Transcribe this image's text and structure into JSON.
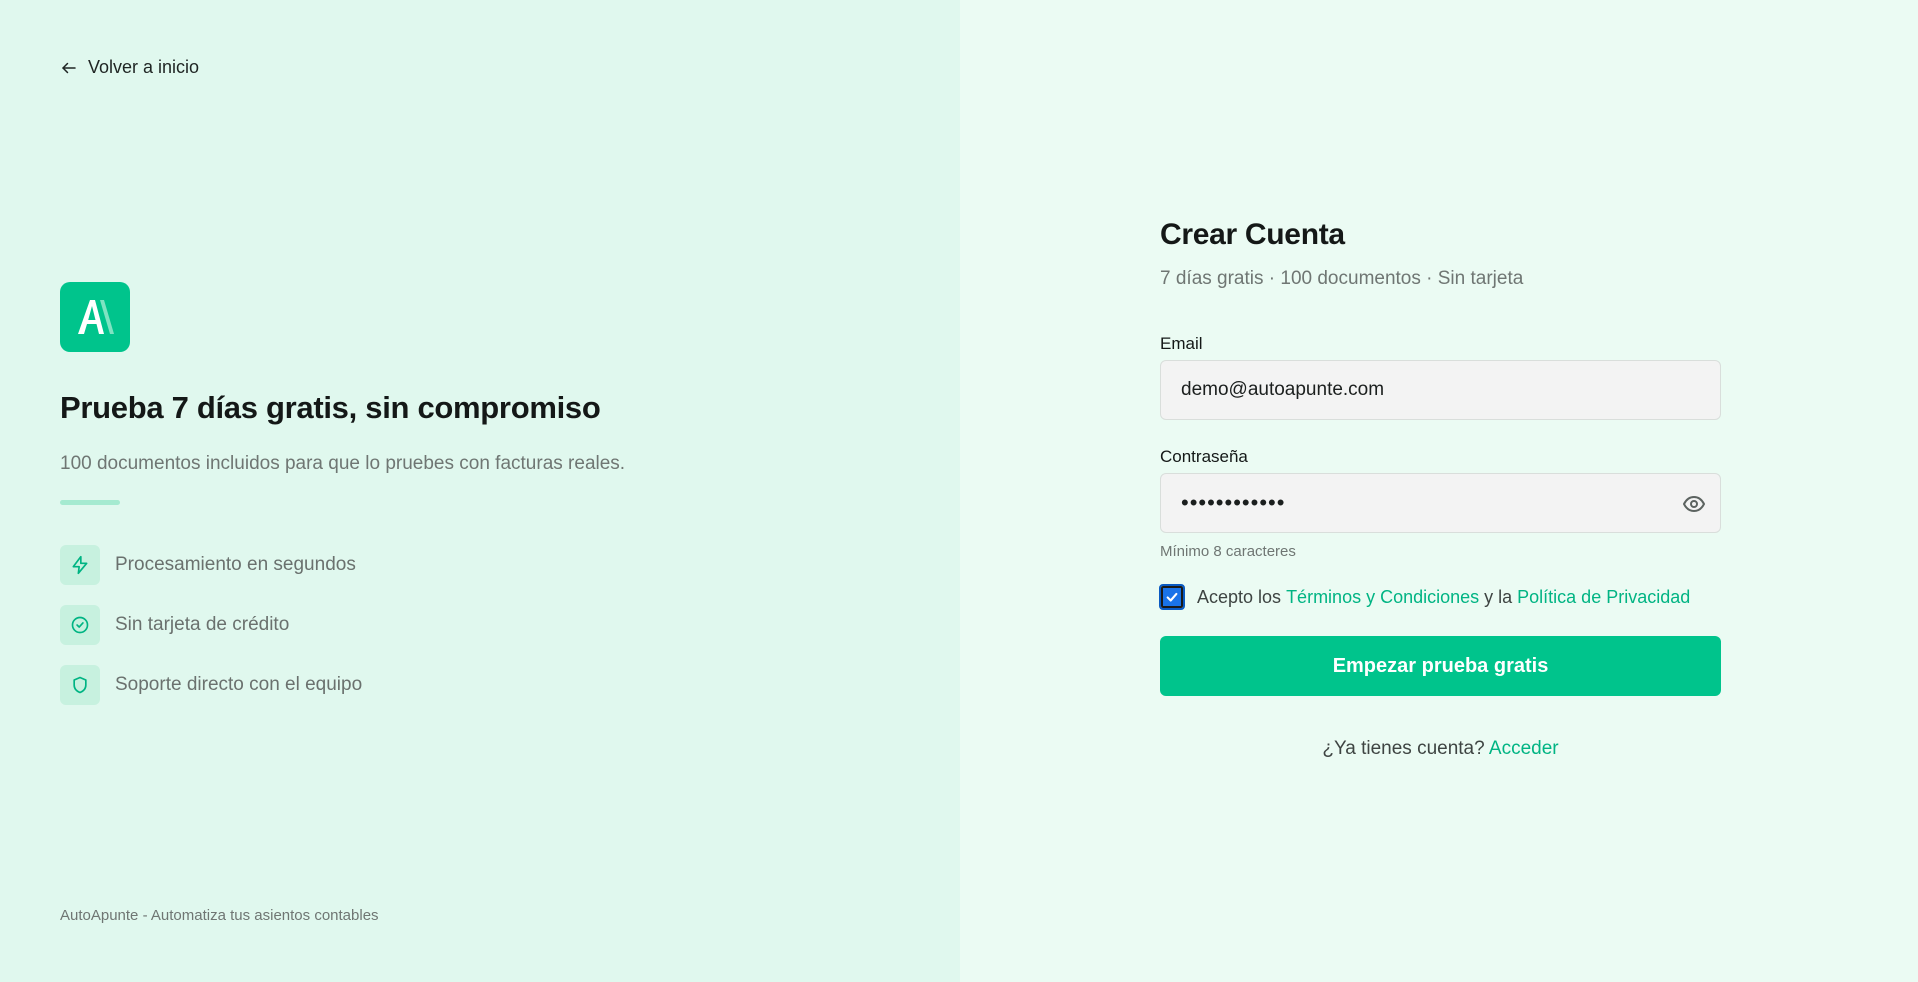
{
  "left": {
    "back_label": "Volver a inicio",
    "title": "Prueba 7 días gratis, sin compromiso",
    "subtitle": "100 documentos incluidos para que lo pruebes con facturas reales.",
    "features": [
      {
        "icon": "lightning-icon",
        "label": "Procesamiento en segundos"
      },
      {
        "icon": "check-circle-icon",
        "label": "Sin tarjeta de crédito"
      },
      {
        "icon": "shield-icon",
        "label": "Soporte directo con el equipo"
      }
    ],
    "footer": "AutoApunte - Automatiza tus asientos contables"
  },
  "form": {
    "title": "Crear Cuenta",
    "subtitle": "7 días gratis · 100 documentos · Sin tarjeta",
    "email_label": "Email",
    "email_value": "demo@autoapunte.com",
    "password_label": "Contraseña",
    "password_value": "••••••••••••",
    "password_hint": "Mínimo 8 caracteres",
    "terms_prefix": "Acepto los ",
    "terms_link": "Términos y Condiciones",
    "terms_middle": " y la ",
    "privacy_link": "Política de Privacidad",
    "terms_checked": true,
    "submit_label": "Empezar prueba gratis",
    "login_prompt": "¿Ya tienes cuenta?",
    "login_link": "Acceder"
  },
  "colors": {
    "brand": "#00c48c",
    "left_bg": "#e0f8ee",
    "right_bg": "#ebfbf3",
    "link": "#00b483"
  }
}
